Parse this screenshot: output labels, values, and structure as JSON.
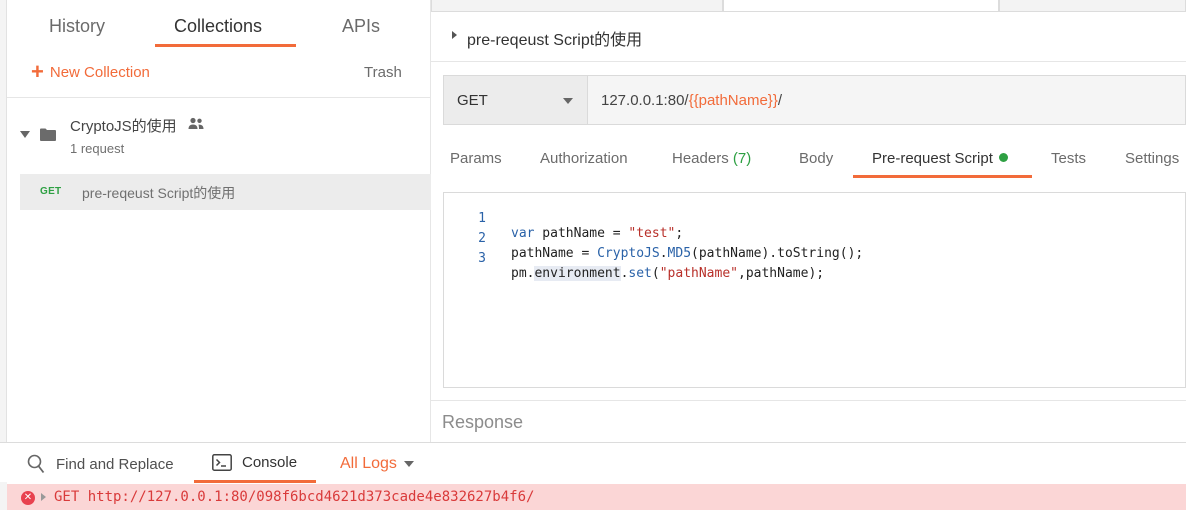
{
  "sidebar": {
    "tabs": [
      {
        "label": "History"
      },
      {
        "label": "Collections"
      },
      {
        "label": "APIs"
      }
    ],
    "new_collection_label": "New Collection",
    "trash_label": "Trash",
    "collection": {
      "name": "CryptoJS的使用",
      "meta": "1 request"
    },
    "request": {
      "method": "GET",
      "name": "pre-reqeust Script的使用"
    }
  },
  "request": {
    "title": "pre-reqeust Script的使用",
    "method": "GET",
    "url_prefix": "127.0.0.1:80/",
    "url_variable": "{{pathName}}",
    "url_suffix": "/"
  },
  "request_tabs": {
    "params": "Params",
    "authorization": "Authorization",
    "headers": "Headers",
    "headers_count": "(7)",
    "body": "Body",
    "pre_request": "Pre-request Script",
    "tests": "Tests",
    "settings": "Settings"
  },
  "editor": {
    "lines": [
      {
        "no": "1",
        "text": "var pathName = \"test\";"
      },
      {
        "no": "2",
        "text": "pathName = CryptoJS.MD5(pathName).toString();"
      },
      {
        "no": "3",
        "text": "pm.environment.set(\"pathName\",pathName);"
      }
    ]
  },
  "response_label": "Response",
  "console": {
    "find_replace_label": "Find and Replace",
    "console_label": "Console",
    "all_logs_label": "All Logs",
    "log_entry": "GET http://127.0.0.1:80/098f6bcd4621d373cade4e832627b4f6/"
  },
  "colors": {
    "accent": "#f26b3a",
    "success": "#2ea043",
    "error": "#e8424f",
    "error_bg": "#fbd6d6"
  }
}
